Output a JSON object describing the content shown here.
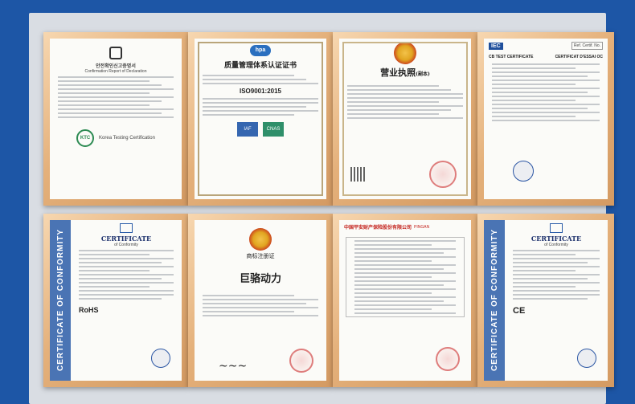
{
  "certificates": [
    {
      "id": "kc",
      "title": "안전확인신고증명서",
      "subtitle": "Confirmation Report of Declaration",
      "footer": "Korea Testing Certification",
      "mark": "KTC"
    },
    {
      "id": "iso",
      "title": "质量管理体系认证证书",
      "logo": "hpa",
      "standard": "ISO9001:2015",
      "badges": [
        "IAF",
        "CNAS"
      ]
    },
    {
      "id": "license",
      "title": "营业执照",
      "subtitle": "(副本)"
    },
    {
      "id": "cb",
      "brand": "IEC",
      "title": "CB TEST CERTIFICATE",
      "title_fr": "CERTIFICAT D'ESSAI OC",
      "ref_label": "Ref. Certif. No."
    },
    {
      "id": "ce",
      "band": "CERTIFICATE OF CONFORMITY",
      "title": "CERTIFICATE",
      "subtitle": "of Conformity",
      "mark": "RoHS"
    },
    {
      "id": "trademark",
      "title": "商标注册证",
      "brand_name": "巨骆动力"
    },
    {
      "id": "insurance",
      "title": "中国平安财产保险股份有限公司",
      "title_en": "PINGAN"
    },
    {
      "id": "ce2",
      "band": "CERTIFICATE OF CONFORMITY",
      "title": "CERTIFICATE",
      "subtitle": "of Conformity",
      "mark": "CE"
    }
  ]
}
